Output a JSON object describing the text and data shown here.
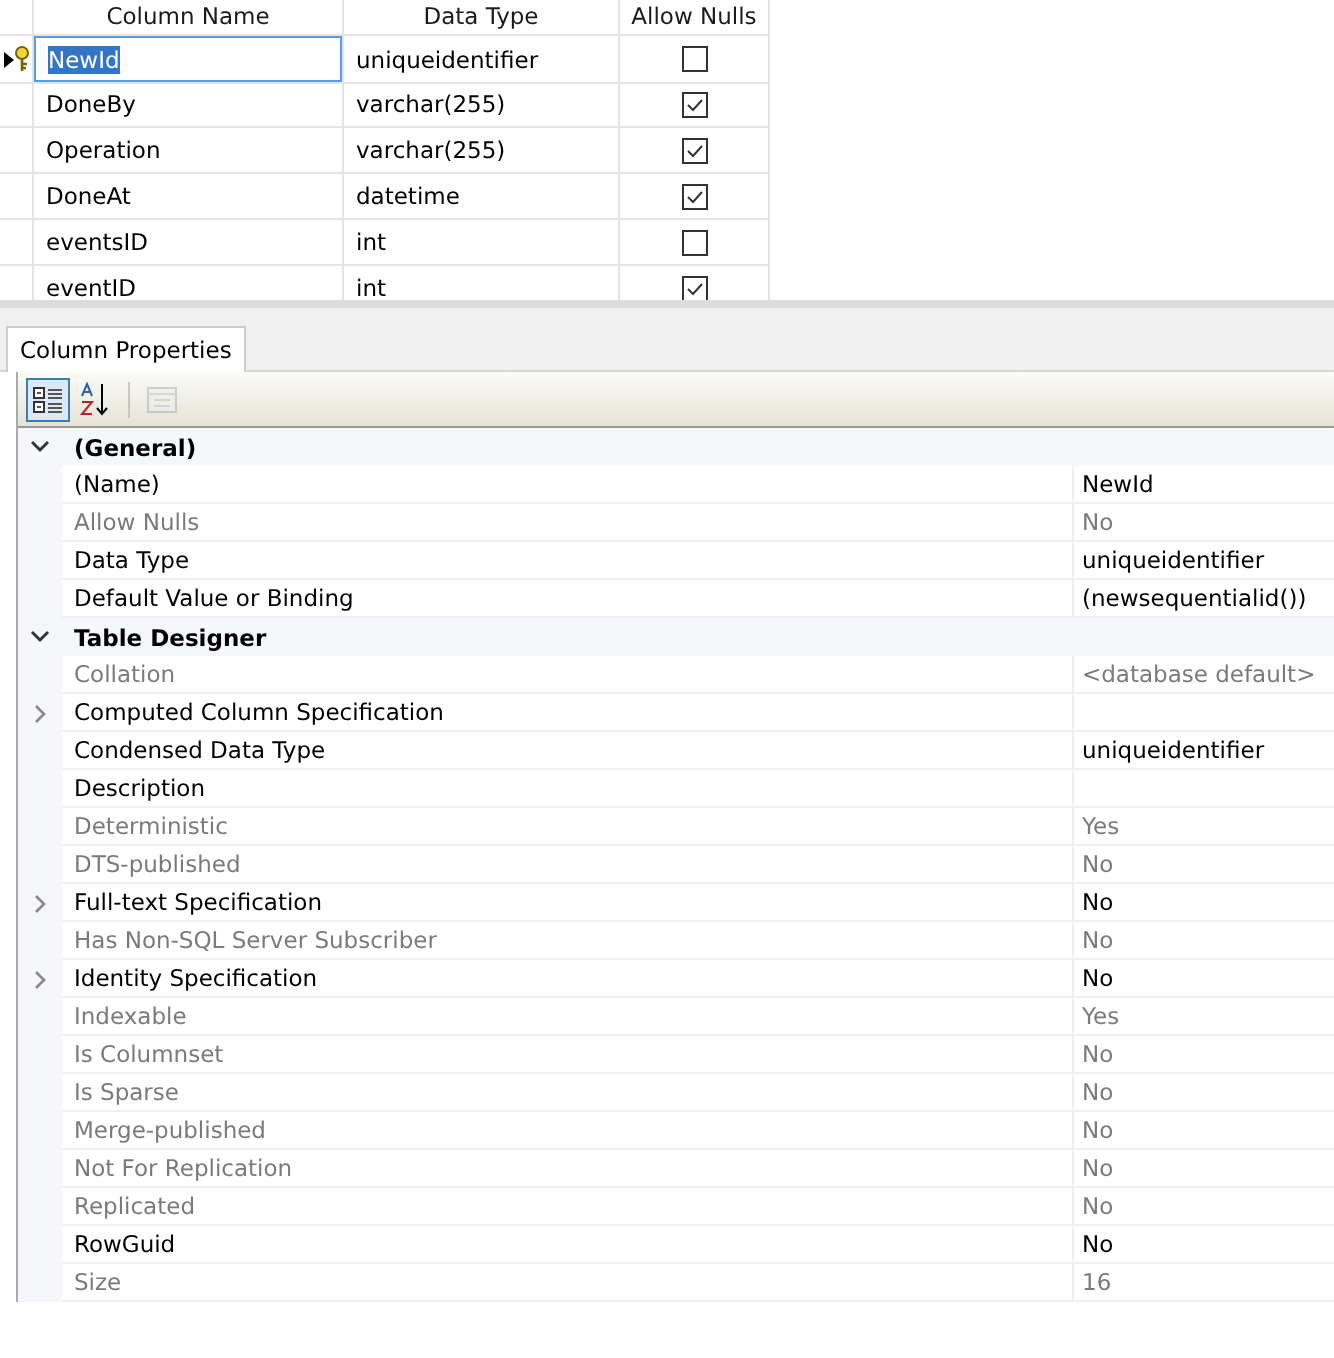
{
  "table": {
    "columns": [
      "Column Name",
      "Data Type",
      "Allow Nulls"
    ],
    "rows": [
      {
        "name": "NewId",
        "type": "uniqueidentifier",
        "allow_nulls": false,
        "selected": true,
        "primary_key": true
      },
      {
        "name": "DoneBy",
        "type": "varchar(255)",
        "allow_nulls": true,
        "selected": false,
        "primary_key": false
      },
      {
        "name": "Operation",
        "type": "varchar(255)",
        "allow_nulls": true,
        "selected": false,
        "primary_key": false
      },
      {
        "name": "DoneAt",
        "type": "datetime",
        "allow_nulls": true,
        "selected": false,
        "primary_key": false
      },
      {
        "name": "eventsID",
        "type": "int",
        "allow_nulls": false,
        "selected": false,
        "primary_key": false
      },
      {
        "name": "eventID",
        "type": "int",
        "allow_nulls": true,
        "selected": false,
        "primary_key": false
      }
    ]
  },
  "properties_panel": {
    "tab": "Column Properties",
    "toolbar": [
      {
        "kind": "categorized",
        "selected": true,
        "disabled": false
      },
      {
        "kind": "alphabetical",
        "selected": false,
        "disabled": false
      },
      {
        "kind": "pages",
        "selected": false,
        "disabled": true
      }
    ],
    "categories": [
      {
        "name": "(General)",
        "expanded": true,
        "properties": [
          {
            "name": "(Name)",
            "value": "NewId",
            "readonly": false,
            "expandable": false
          },
          {
            "name": "Allow Nulls",
            "value": "No",
            "readonly": true,
            "expandable": false
          },
          {
            "name": "Data Type",
            "value": "uniqueidentifier",
            "readonly": false,
            "expandable": false
          },
          {
            "name": "Default Value or Binding",
            "value": "(newsequentialid())",
            "readonly": false,
            "expandable": false
          }
        ]
      },
      {
        "name": "Table Designer",
        "expanded": true,
        "properties": [
          {
            "name": "Collation",
            "value": "<database default>",
            "readonly": true,
            "expandable": false
          },
          {
            "name": "Computed Column Specification",
            "readonly": false,
            "expandable": true
          },
          {
            "name": "Condensed Data Type",
            "value": "uniqueidentifier",
            "readonly": false,
            "expandable": false
          },
          {
            "name": "Description",
            "readonly": false,
            "expandable": false
          },
          {
            "name": "Deterministic",
            "value": "Yes",
            "readonly": true,
            "expandable": false
          },
          {
            "name": "DTS-published",
            "value": "No",
            "readonly": true,
            "expandable": false
          },
          {
            "name": "Full-text Specification",
            "value": "No",
            "readonly": false,
            "expandable": true
          },
          {
            "name": "Has Non-SQL Server Subscriber",
            "value": "No",
            "readonly": true,
            "expandable": false
          },
          {
            "name": "Identity Specification",
            "value": "No",
            "readonly": false,
            "expandable": true
          },
          {
            "name": "Indexable",
            "value": "Yes",
            "readonly": true,
            "expandable": false
          },
          {
            "name": "Is Columnset",
            "value": "No",
            "readonly": true,
            "expandable": false
          },
          {
            "name": "Is Sparse",
            "value": "No",
            "readonly": true,
            "expandable": false
          },
          {
            "name": "Merge-published",
            "value": "No",
            "readonly": true,
            "expandable": false
          },
          {
            "name": "Not For Replication",
            "value": "No",
            "readonly": true,
            "expandable": false
          },
          {
            "name": "Replicated",
            "value": "No",
            "readonly": true,
            "expandable": false
          },
          {
            "name": "RowGuid",
            "value": "No",
            "readonly": false,
            "expandable": false
          },
          {
            "name": "Size",
            "value": "16",
            "readonly": true,
            "expandable": false
          }
        ]
      }
    ]
  }
}
